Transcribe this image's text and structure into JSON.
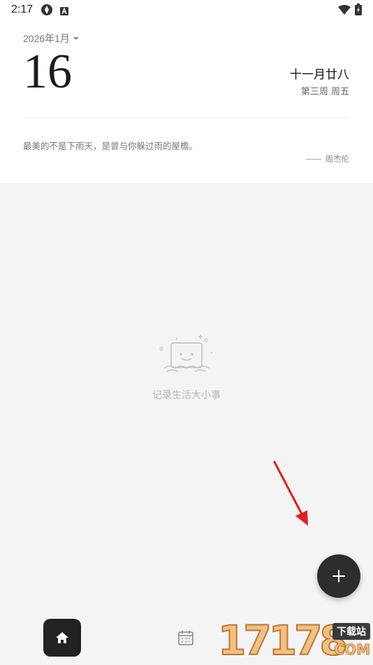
{
  "status_bar": {
    "time": "2:17",
    "icons": [
      "sync-icon",
      "a-icon",
      "wifi-icon",
      "battery-icon"
    ]
  },
  "header": {
    "month_label": "2026年1月",
    "day": "16",
    "lunar_date": "十一月廿八",
    "week_info": "第三周 周五",
    "quote": "最美的不是下雨天，是曾与你躲过雨的屋檐。",
    "quote_author": "周杰伦"
  },
  "empty_state": {
    "text": "记录生活大小事",
    "icon": "empty-note-illustration"
  },
  "fab": {
    "icon": "plus-icon",
    "color": "#2d2d2d"
  },
  "bottom_nav": {
    "items": [
      {
        "icon": "home-icon",
        "active": true
      },
      {
        "icon": "calendar-icon",
        "active": false
      }
    ]
  },
  "watermark": {
    "number": "17178",
    "badge": "下载站",
    "suffix": "COM"
  },
  "colors": {
    "background": "#f4f4f4",
    "card": "#ffffff",
    "accent_dark": "#222222",
    "annotation_arrow": "#e02020"
  }
}
